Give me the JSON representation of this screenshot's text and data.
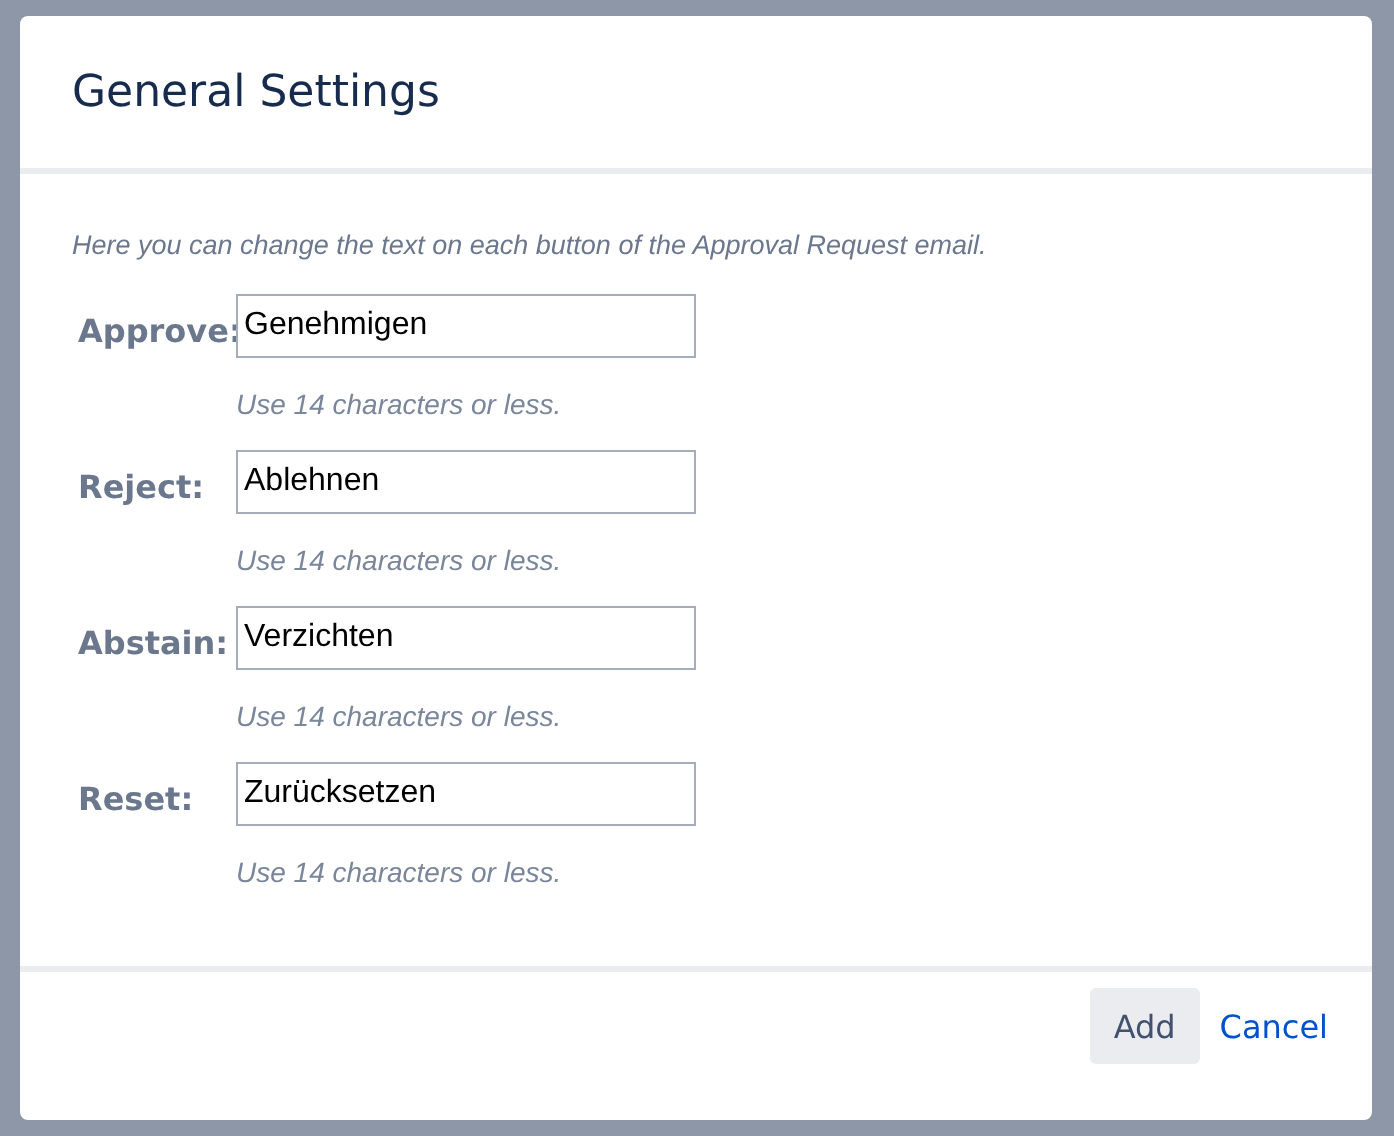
{
  "dialog": {
    "title": "General Settings",
    "description": "Here you can change the text on each button of the Approval Request email.",
    "fields": [
      {
        "label": "Approve:",
        "value": "Genehmigen",
        "hint": "Use 14 characters or less."
      },
      {
        "label": "Reject:",
        "value": "Ablehnen",
        "hint": "Use 14 characters or less."
      },
      {
        "label": "Abstain:",
        "value": "Verzichten",
        "hint": "Use 14 characters or less."
      },
      {
        "label": "Reset:",
        "value": "Zurücksetzen",
        "hint": "Use 14 characters or less."
      }
    ],
    "buttons": [
      {
        "label": "Add",
        "kind": "primary"
      },
      {
        "label": "Cancel",
        "kind": "link"
      }
    ]
  }
}
